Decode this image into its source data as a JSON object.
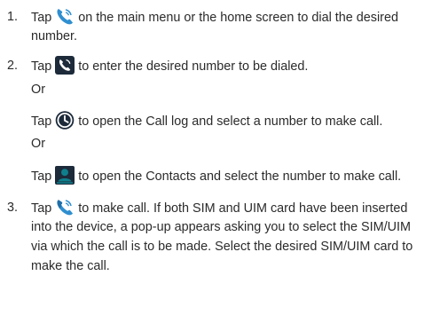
{
  "steps": [
    {
      "number": "1.",
      "lead": "Tap",
      "icon": "phone-icon",
      "line1": "on the main menu or the home screen to dial the desired",
      "line2": "number."
    },
    {
      "number": "2.",
      "lead": "Tap",
      "icon": "dialpad-phone-icon",
      "line1": "to enter the desired number to be dialed."
    },
    {
      "number": "3.",
      "lead": "Tap",
      "icon": "call-button-icon",
      "line1": "to make call. If both SIM and UIM card have been inserted",
      "line2": "into the device, a pop-up appears asking you to select the SIM/UIM",
      "line3": "via which the call is to be made. Select the desired SIM/UIM card to",
      "line4": "make the call."
    }
  ],
  "alternatives": [
    {
      "or_label": "Or",
      "lead": "Tap",
      "icon": "call-log-clock-icon",
      "text": "to open the Call log and select a number to make call."
    },
    {
      "or_label": "Or",
      "lead": "Tap",
      "icon": "contacts-person-icon",
      "text": "to open the Contacts and select the number to make call."
    }
  ],
  "colors": {
    "text": "#2b2b2b",
    "phone_blue": "#2f8fd0",
    "icon_dark": "#1c2a3a",
    "icon_teal": "#0f7f8c"
  }
}
